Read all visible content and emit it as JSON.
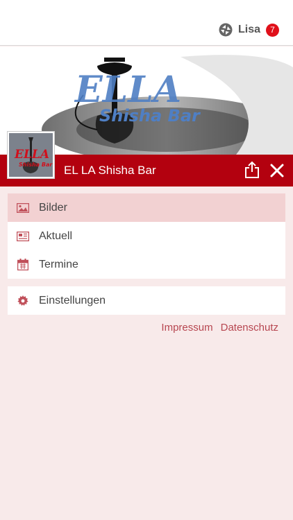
{
  "header": {
    "user_name": "Lisa",
    "notification_count": "7"
  },
  "banner": {
    "logo_text_top": "ELLA",
    "logo_text_bottom": "Shisha Bar"
  },
  "titlebar": {
    "title": "EL LA Shisha Bar"
  },
  "thumbnail": {
    "logo_text_top": "ELLA",
    "logo_text_bottom": "Shisha Bar"
  },
  "menu": {
    "items": [
      {
        "label": "Bilder",
        "icon": "image-icon"
      },
      {
        "label": "Aktuell",
        "icon": "newspaper-icon"
      },
      {
        "label": "Termine",
        "icon": "calendar-icon"
      }
    ],
    "settings": {
      "label": "Einstellungen",
      "icon": "gear-icon"
    }
  },
  "footer_links": {
    "impressum": "Impressum",
    "datenschutz": "Datenschutz"
  },
  "colors": {
    "brand_red": "#b3010f",
    "active_item_bg": "#f2d1d2",
    "page_bg": "#f8eaea",
    "icon_red": "#c0505a",
    "link_color": "#b74650"
  }
}
